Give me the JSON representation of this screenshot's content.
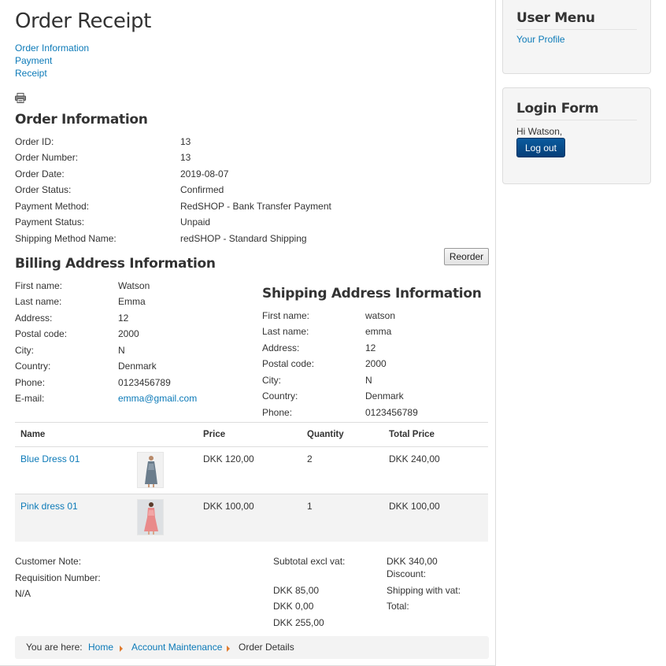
{
  "page": {
    "title": "Order Receipt"
  },
  "steps": [
    "Order Information",
    "Payment",
    "Receipt"
  ],
  "order_info": {
    "heading": "Order Information",
    "rows": [
      {
        "label": "Order ID:",
        "value": "13"
      },
      {
        "label": "Order Number:",
        "value": "13"
      },
      {
        "label": "Order Date:",
        "value": "2019-08-07"
      },
      {
        "label": "Order Status:",
        "value": "Confirmed"
      },
      {
        "label": "Payment Method:",
        "value": "RedSHOP - Bank Transfer Payment"
      },
      {
        "label": "Payment Status:",
        "value": "Unpaid"
      },
      {
        "label": "Shipping Method Name:",
        "value": "redSHOP - Standard Shipping"
      }
    ]
  },
  "reorder_label": "Reorder",
  "billing": {
    "heading": "Billing Address Information",
    "rows": [
      {
        "label": "First name:",
        "value": "Watson"
      },
      {
        "label": "Last name:",
        "value": "Emma"
      },
      {
        "label": "Address:",
        "value": "12"
      },
      {
        "label": "Postal code:",
        "value": "2000"
      },
      {
        "label": "City:",
        "value": "N"
      },
      {
        "label": "Country:",
        "value": "Denmark"
      },
      {
        "label": "Phone:",
        "value": "0123456789"
      },
      {
        "label": "E-mail:",
        "value": "emma@gmail.com"
      }
    ]
  },
  "shipping": {
    "heading": "Shipping Address Information",
    "rows": [
      {
        "label": "First name:",
        "value": "watson"
      },
      {
        "label": "Last name:",
        "value": "emma"
      },
      {
        "label": "Address:",
        "value": "12"
      },
      {
        "label": "Postal code:",
        "value": "2000"
      },
      {
        "label": "City:",
        "value": "N"
      },
      {
        "label": "Country:",
        "value": "Denmark"
      },
      {
        "label": "Phone:",
        "value": "0123456789"
      }
    ]
  },
  "items_table": {
    "headers": {
      "name": "Name",
      "price": "Price",
      "quantity": "Quantity",
      "total": "Total Price"
    },
    "rows": [
      {
        "name": "Blue Dress 01",
        "price": "DKK 120,00",
        "quantity": "2",
        "total": "DKK 240,00"
      },
      {
        "name": "Pink dress 01",
        "price": "DKK 100,00",
        "quantity": "1",
        "total": "DKK 100,00"
      }
    ]
  },
  "notes": {
    "customer_note_label": "Customer Note:",
    "requisition_label": "Requisition Number:",
    "requisition_value": "N/A"
  },
  "totals": {
    "subtotal_label": "Subtotal excl vat:",
    "subtotal_value": "DKK 340,00",
    "discount_label": "Discount:",
    "discount_value": "DKK 85,00",
    "shipping_label": "Shipping with vat:",
    "shipping_value": "DKK 0,00",
    "total_label": "Total:",
    "total_value": "DKK 255,00"
  },
  "breadcrumb": {
    "prefix": "You are here:",
    "items": [
      "Home",
      "Account Maintenance",
      "Order Details"
    ]
  },
  "user_menu": {
    "title": "User Menu",
    "items": [
      "Your Profile"
    ]
  },
  "login_form": {
    "title": "Login Form",
    "greeting": "Hi Watson,",
    "logout_label": "Log out"
  }
}
